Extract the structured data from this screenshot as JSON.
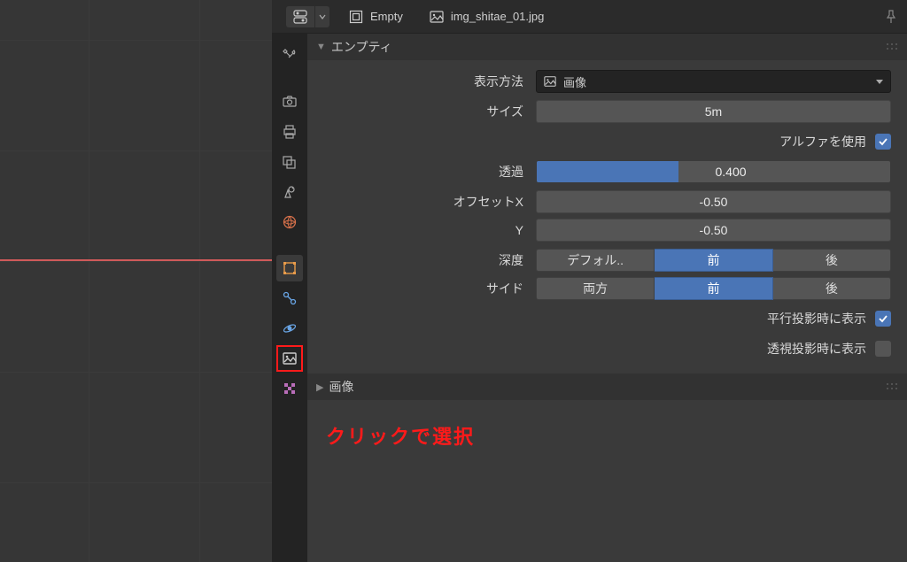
{
  "header": {
    "object_name": "Empty",
    "data_name": "img_shitae_01.jpg"
  },
  "section_empty": {
    "title": "エンプティ",
    "display_as_label": "表示方法",
    "display_as_value": "画像",
    "size_label": "サイズ",
    "size_value": "5m",
    "use_alpha_label": "アルファを使用",
    "opacity_label": "透過",
    "opacity_value": "0.400",
    "offset_x_label": "オフセットX",
    "offset_x_value": "-0.50",
    "offset_y_label": "Y",
    "offset_y_value": "-0.50",
    "depth_label": "深度",
    "depth_options": [
      "デフォル..",
      "前",
      "後"
    ],
    "depth_active": 1,
    "side_label": "サイド",
    "side_options": [
      "両方",
      "前",
      "後"
    ],
    "side_active": 1,
    "show_ortho_label": "平行投影時に表示",
    "show_persp_label": "透視投影時に表示"
  },
  "section_image": {
    "title": "画像"
  },
  "annotation": "クリックで選択"
}
